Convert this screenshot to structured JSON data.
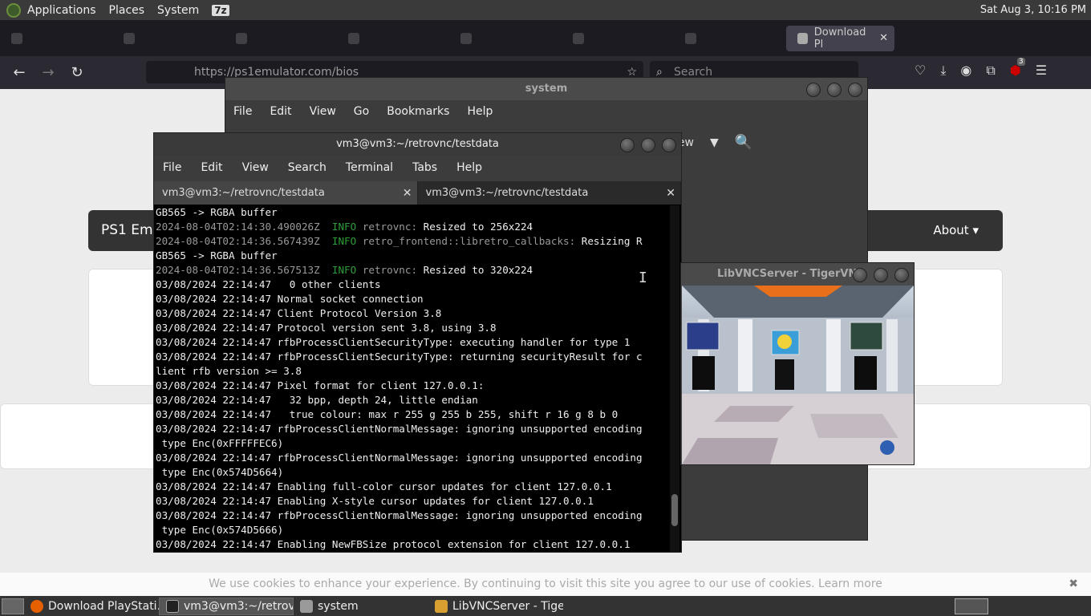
{
  "top_panel": {
    "menus": [
      "Applications",
      "Places",
      "System"
    ],
    "badge": "7z",
    "clock": "Sat Aug  3, 10:16 PM"
  },
  "firefox": {
    "active_tab": "Download Pl",
    "url": "https://ps1emulator.com/bios",
    "search_placeholder": "Search",
    "notification_count": "3"
  },
  "webpage": {
    "brand": "PS1 Em",
    "about": "About ▾",
    "cookie_notice": "We use cookies to enhance your experience. By continuing to visit this site you agree to our use of cookies. Learn more"
  },
  "system_window": {
    "title": "system",
    "menu": [
      "File",
      "Edit",
      "View",
      "Go",
      "Bookmarks",
      "Help"
    ],
    "toolbar_view": "iew"
  },
  "terminal": {
    "title": "vm3@vm3:~/retrovnc/testdata",
    "menu": [
      "File",
      "Edit",
      "View",
      "Search",
      "Terminal",
      "Tabs",
      "Help"
    ],
    "tabs": [
      "vm3@vm3:~/retrovnc/testdata",
      "vm3@vm3:~/retrovnc/testdata"
    ],
    "lines": [
      {
        "text": "GB565 -> RGBA buffer"
      },
      {
        "ts": "2024-08-04T02:14:30.490026Z",
        "lvl": "INFO",
        "mod": "retrovnc:",
        "text": " Resized to 256x224"
      },
      {
        "ts": "2024-08-04T02:14:36.567439Z",
        "lvl": "INFO",
        "mod": "retro_frontend::libretro_callbacks:",
        "text": " Resizing R"
      },
      {
        "text": "GB565 -> RGBA buffer"
      },
      {
        "ts": "2024-08-04T02:14:36.567513Z",
        "lvl": "INFO",
        "mod": "retrovnc:",
        "text": " Resized to 320x224"
      },
      {
        "text": "03/08/2024 22:14:47   0 other clients"
      },
      {
        "text": "03/08/2024 22:14:47 Normal socket connection"
      },
      {
        "text": "03/08/2024 22:14:47 Client Protocol Version 3.8"
      },
      {
        "text": "03/08/2024 22:14:47 Protocol version sent 3.8, using 3.8"
      },
      {
        "text": "03/08/2024 22:14:47 rfbProcessClientSecurityType: executing handler for type 1"
      },
      {
        "text": "03/08/2024 22:14:47 rfbProcessClientSecurityType: returning securityResult for c"
      },
      {
        "text": "lient rfb version >= 3.8"
      },
      {
        "text": "03/08/2024 22:14:47 Pixel format for client 127.0.0.1:"
      },
      {
        "text": "03/08/2024 22:14:47   32 bpp, depth 24, little endian"
      },
      {
        "text": "03/08/2024 22:14:47   true colour: max r 255 g 255 b 255, shift r 16 g 8 b 0"
      },
      {
        "text": "03/08/2024 22:14:47 rfbProcessClientNormalMessage: ignoring unsupported encoding"
      },
      {
        "text": " type Enc(0xFFFFFEC6)"
      },
      {
        "text": "03/08/2024 22:14:47 rfbProcessClientNormalMessage: ignoring unsupported encoding"
      },
      {
        "text": " type Enc(0x574D5664)"
      },
      {
        "text": "03/08/2024 22:14:47 Enabling full-color cursor updates for client 127.0.0.1"
      },
      {
        "text": "03/08/2024 22:14:47 Enabling X-style cursor updates for client 127.0.0.1"
      },
      {
        "text": "03/08/2024 22:14:47 rfbProcessClientNormalMessage: ignoring unsupported encoding"
      },
      {
        "text": " type Enc(0x574D5666)"
      },
      {
        "text": "03/08/2024 22:14:47 Enabling NewFBSize protocol extension for client 127.0.0.1"
      }
    ]
  },
  "vnc_window": {
    "title": "LibVNCServer - TigerVNC"
  },
  "taskbar": {
    "items": [
      {
        "label": "Download PlayStati...",
        "icon": "firefox-icon"
      },
      {
        "label": "vm3@vm3:~/retrov...",
        "icon": "terminal-icon",
        "active": true
      },
      {
        "label": "system",
        "icon": "folder-icon"
      },
      {
        "label": "LibVNCServer - Tige...",
        "icon": "tigervnc-icon"
      }
    ]
  }
}
